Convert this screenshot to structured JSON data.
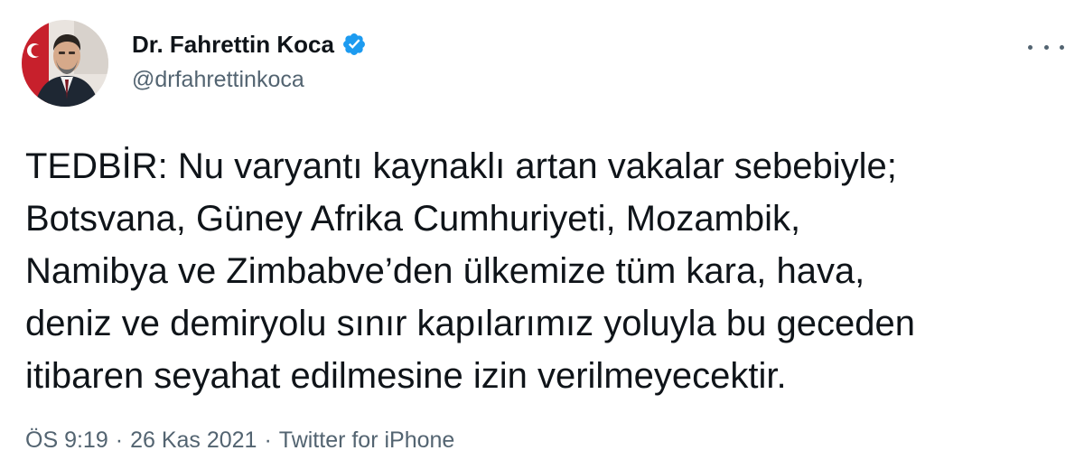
{
  "author": {
    "display_name": "Dr. Fahrettin Koca",
    "handle": "@drfahrettinkoca",
    "verified": true,
    "verified_color": "#1d9bf0"
  },
  "tweet": {
    "lines": [
      "TEDBİR: Nu varyantı kaynaklı artan vakalar sebebiyle;",
      "Botsvana, Güney Afrika Cumhuriyeti, Mozambik,",
      "Namibya ve Zimbabve’den ülkemize tüm kara, hava,",
      "deniz ve demiryolu sınır kapılarımız yoluyla bu geceden",
      "itibaren seyahat edilmesine izin verilmeyecektir."
    ]
  },
  "meta": {
    "time": "ÖS 9:19",
    "date": "26 Kas 2021",
    "separator": "·",
    "source": "Twitter for iPhone"
  },
  "icons": {
    "more": "more-horizontal-icon",
    "verified": "verified-badge-icon"
  },
  "colors": {
    "text_primary": "#0f1419",
    "text_secondary": "#536471",
    "background": "#ffffff"
  }
}
